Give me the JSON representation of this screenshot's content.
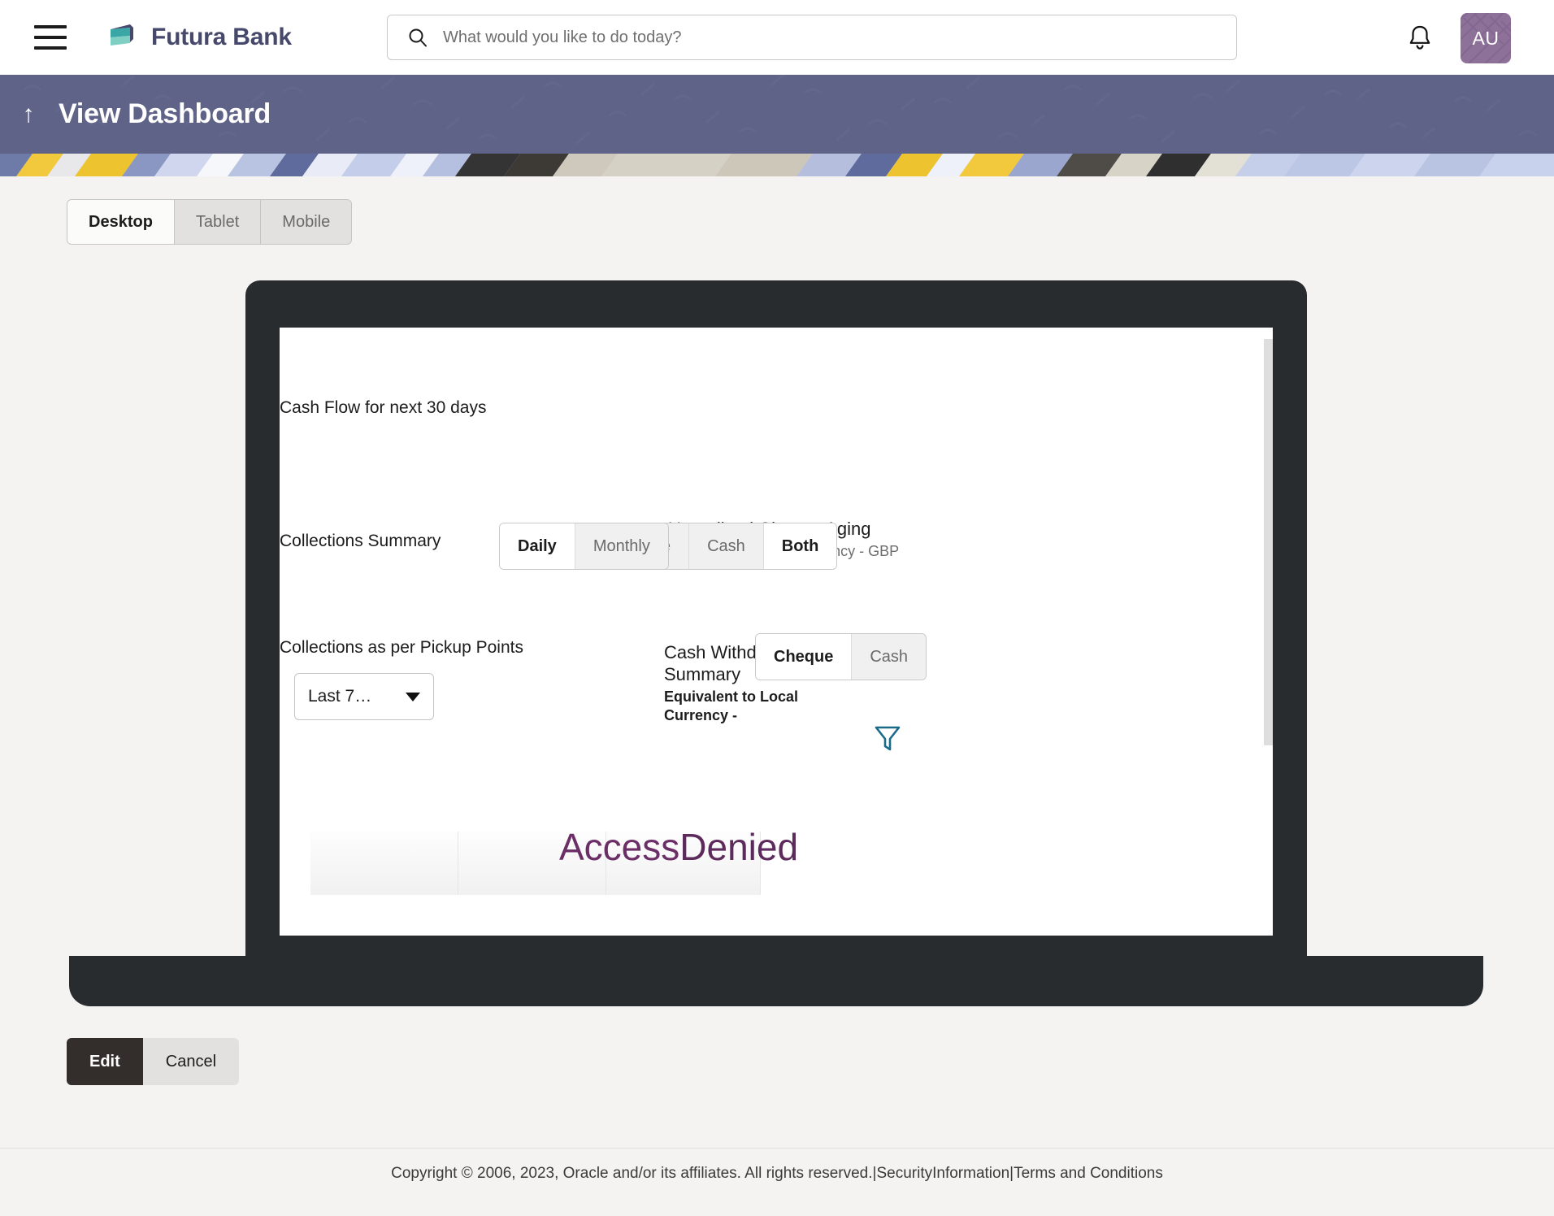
{
  "header": {
    "menu_icon": "hamburger-icon",
    "brand_name": "Futura Bank",
    "search_placeholder": "What would you like to do today?",
    "search_value": "",
    "search_icon": "search-icon",
    "notification_icon": "bell-icon",
    "avatar_initials": "AU"
  },
  "banner": {
    "back_icon": "up-arrow-icon",
    "title": "View Dashboard",
    "background_color": "#5e6387"
  },
  "device_tabs": [
    {
      "label": "Desktop",
      "active": true
    },
    {
      "label": "Tablet",
      "active": false
    },
    {
      "label": "Mobile",
      "active": false
    }
  ],
  "preview": {
    "widgets": {
      "cash_flow_label": "Cash Flow for next 30 days",
      "collections_summary_label": "Collections Summary",
      "collections_pickup_label": "Collections as per Pickup Points",
      "unrealized_title": "Unrealized Cheque Aging",
      "unrealized_subtitle": "Equivalent to Local Currency - GBP",
      "cash_withdrawal_title": "Cash Withdrawal Summary",
      "cash_withdrawal_subtitle": "Equivalent to Local Currency -",
      "filter_icon": "funnel-filter-icon",
      "denied_message_part1": "Access",
      "denied_message_part2": "Denied",
      "denied_color": "#6b2e66"
    },
    "frequency_toggle": [
      {
        "label": "Daily",
        "active": true
      },
      {
        "label": "Monthly",
        "active": false
      }
    ],
    "instrument_toggle": [
      {
        "label": "Cheque",
        "active": false
      },
      {
        "label": "Cash",
        "active": false
      },
      {
        "label": "Both",
        "active": true
      }
    ],
    "pickup_instrument_toggle": [
      {
        "label": "Cheque",
        "active": true
      },
      {
        "label": "Cash",
        "active": false
      }
    ],
    "period_dropdown": {
      "selected": "Last 7…",
      "caret_icon": "chevron-down-icon"
    }
  },
  "actions": {
    "edit_label": "Edit",
    "cancel_label": "Cancel"
  },
  "footer": {
    "copyright": "Copyright © 2006, 2023, Oracle and/or its affiliates. All rights reserved.",
    "separator1": "|",
    "security_information": "SecurityInformation",
    "separator2": "|",
    "terms": "Terms and Conditions"
  }
}
